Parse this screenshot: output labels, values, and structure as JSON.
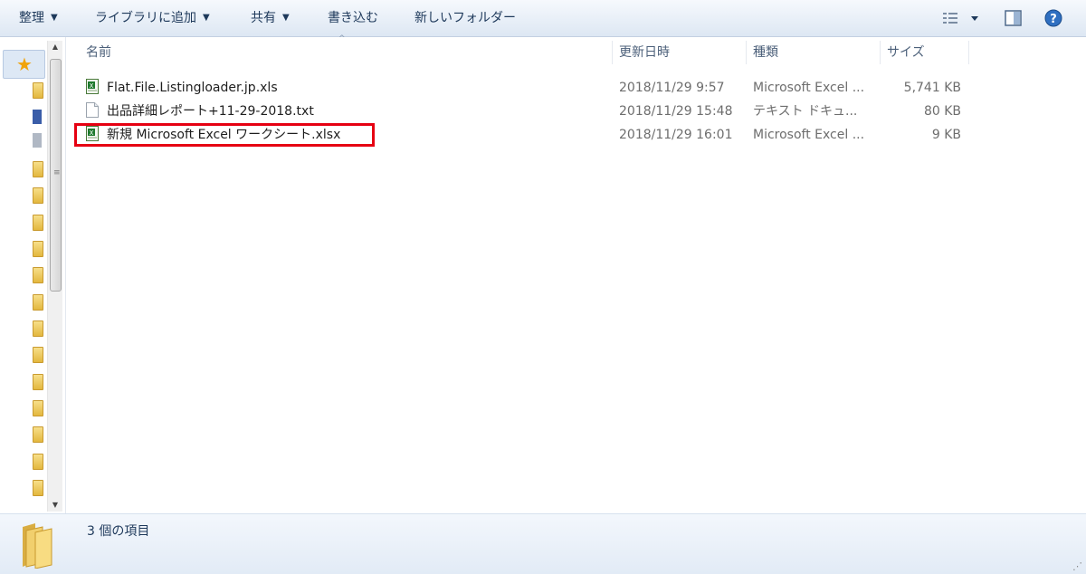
{
  "toolbar": {
    "organize": "整理",
    "add_to_library": "ライブラリに追加",
    "share": "共有",
    "burn": "書き込む",
    "new_folder": "新しいフォルダー",
    "view_icon": "view-options-icon",
    "preview_icon": "preview-pane-icon",
    "help_icon": "help-icon"
  },
  "columns": {
    "name": "名前",
    "modified": "更新日時",
    "type": "種類",
    "size": "サイズ"
  },
  "files": [
    {
      "name": "Flat.File.Listingloader.jp.xls",
      "modified": "2018/11/29 9:57",
      "type": "Microsoft Excel ...",
      "size": "5,741 KB",
      "icon": "excel-icon"
    },
    {
      "name": "出品詳細レポート+11-29-2018.txt",
      "modified": "2018/11/29 15:48",
      "type": "テキスト ドキュ...",
      "size": "80 KB",
      "icon": "text-file-icon"
    },
    {
      "name": "新規 Microsoft Excel ワークシート.xlsx",
      "modified": "2018/11/29 16:01",
      "type": "Microsoft Excel ...",
      "size": "9 KB",
      "icon": "excel-icon"
    }
  ],
  "status": {
    "item_count": "3 個の項目"
  },
  "colors": {
    "highlight_border": "#e60012",
    "toolbar_text": "#1e395b"
  }
}
